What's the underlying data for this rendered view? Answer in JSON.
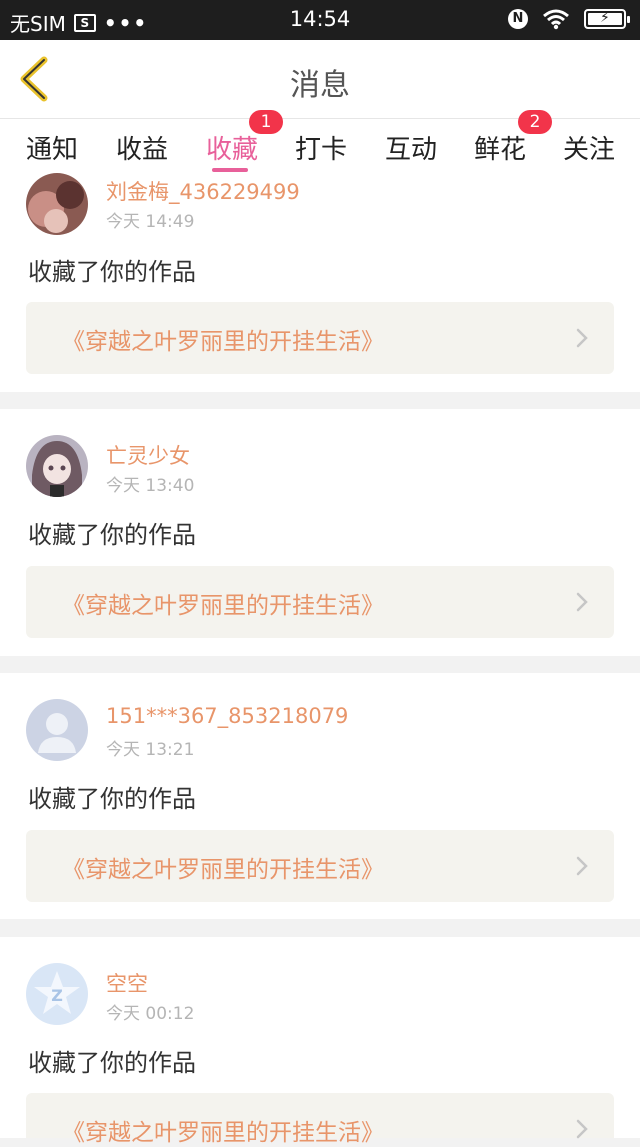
{
  "status_bar": {
    "carrier": "无SIM",
    "sim_icon_text": "S",
    "dots": "•••",
    "time": "14:54",
    "nfc_icon_text": "N"
  },
  "nav": {
    "title": "消息"
  },
  "tabs": [
    {
      "label": "通知"
    },
    {
      "label": "收益"
    },
    {
      "label": "收藏",
      "badge": "1",
      "active": true
    },
    {
      "label": "打卡"
    },
    {
      "label": "互动"
    },
    {
      "label": "鲜花",
      "badge": "2"
    },
    {
      "label": "关注"
    }
  ],
  "messages": [
    {
      "user": "刘金梅_436229499",
      "time": "今天 14:49",
      "action": "收藏了你的作品",
      "work": "《穿越之叶罗丽里的开挂生活》"
    },
    {
      "user": "亡灵少女",
      "time": "今天 13:40",
      "action": "收藏了你的作品",
      "work": "《穿越之叶罗丽里的开挂生活》"
    },
    {
      "user": "151***367_853218079",
      "time": "今天 13:21",
      "action": "收藏了你的作品",
      "work": "《穿越之叶罗丽里的开挂生活》"
    },
    {
      "user": "空空",
      "time": "今天 00:12",
      "action": "收藏了你的作品",
      "work": "《穿越之叶罗丽里的开挂生活》"
    }
  ],
  "colors": {
    "accent_pink": "#e8609a",
    "name_orange": "#e8956a",
    "badge_red": "#f2344a"
  }
}
